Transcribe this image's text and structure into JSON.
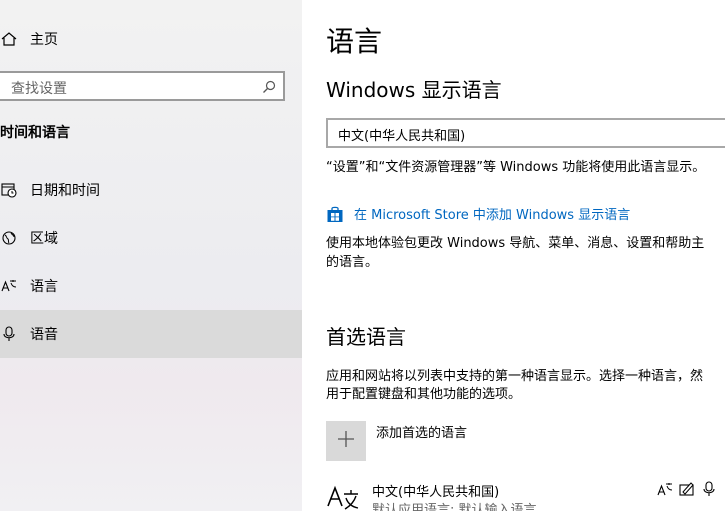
{
  "sidebar": {
    "home_label": "主页",
    "search_placeholder": "查找设置",
    "section_title": "时间和语言",
    "items": [
      {
        "label": "日期和时间"
      },
      {
        "label": "区域"
      },
      {
        "label": "语言"
      },
      {
        "label": "语音"
      }
    ]
  },
  "main": {
    "title": "语言",
    "display_language": {
      "heading": "Windows 显示语言",
      "selected": "中文(中华人民共和国)",
      "description": "“设置”和“文件资源管理器”等 Windows 功能将使用此语言显示。",
      "store_link": "在 Microsoft Store 中添加 Windows 显示语言",
      "store_desc_line1": "使用本地体验包更改 Windows 导航、菜单、消息、设置和帮助主",
      "store_desc_line2": "的语言。"
    },
    "preferred": {
      "heading": "首选语言",
      "desc_line1": "应用和网站将以列表中支持的第一种语言显示。选择一种语言，然",
      "desc_line2": "用于配置键盘和其他功能的选项。",
      "add_label": "添加首选的语言",
      "language_name": "中文(中华人民共和国)",
      "language_sub": "默认应用语言; 默认输入语言"
    }
  },
  "colors": {
    "accent": "#0067c0",
    "selected_bg": "#dadada"
  }
}
